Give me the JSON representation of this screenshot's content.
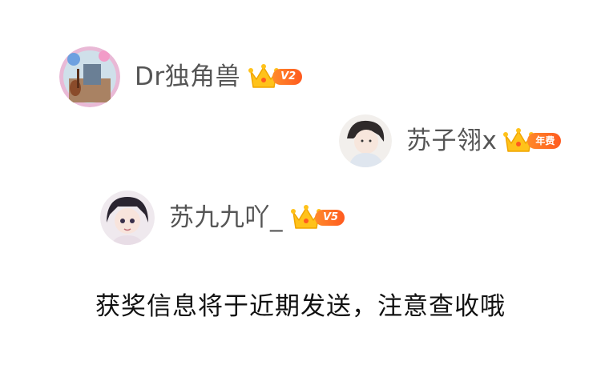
{
  "winners": [
    {
      "username": "Dr独角兽",
      "badge": "V2"
    },
    {
      "username": "苏子翎x",
      "badge": "年费"
    },
    {
      "username": "苏九九吖_",
      "badge": "V5"
    }
  ],
  "notice": "获奖信息将于近期发送，注意查收哦",
  "colors": {
    "crown": "#ffc21a",
    "badge_start": "#ff8a2a",
    "badge_end": "#ff5a1f",
    "username": "#555555"
  }
}
